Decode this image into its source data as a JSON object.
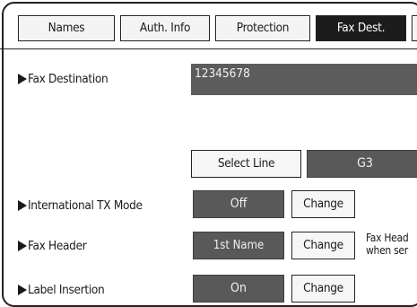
{
  "tabs": [
    {
      "label": "Names",
      "active": false
    },
    {
      "label": "Auth. Info",
      "active": false
    },
    {
      "label": "Protection",
      "active": false
    },
    {
      "label": "Fax Dest.",
      "active": true
    }
  ],
  "fax_destination": {
    "label": "Fax Destination",
    "value": "12345678"
  },
  "line": {
    "select_label": "Select Line",
    "value": "G3"
  },
  "international_tx": {
    "label": "International TX Mode",
    "value": "Off",
    "change_label": "Change"
  },
  "fax_header": {
    "label": "Fax Header",
    "value": "1st Name",
    "change_label": "Change",
    "note_line1": "Fax Head",
    "note_line2": "when ser"
  },
  "label_insertion": {
    "label": "Label Insertion",
    "value": "On",
    "change_label": "Change"
  },
  "colors": {
    "active_tab": "#1c1c1c",
    "value_box": "#595959",
    "dest_field": "#5c5c5c"
  },
  "icons": [
    "right-triangle-icon"
  ]
}
